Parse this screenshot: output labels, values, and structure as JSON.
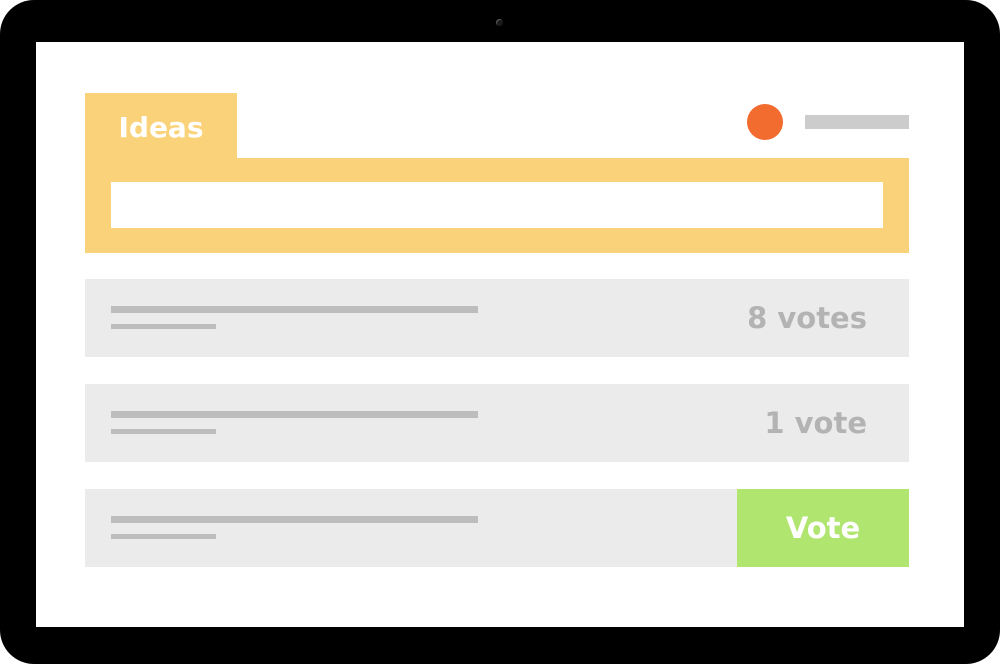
{
  "header": {
    "tab_label": "Ideas"
  },
  "search": {
    "value": "",
    "placeholder": ""
  },
  "ideas": [
    {
      "vote_label": "8 votes"
    },
    {
      "vote_label": "1 vote"
    },
    {
      "vote_button_label": "Vote"
    }
  ],
  "colors": {
    "accent": "#fad27a",
    "avatar": "#f26b2f",
    "vote_button": "#b0e570",
    "row_background": "#ebebeb"
  }
}
